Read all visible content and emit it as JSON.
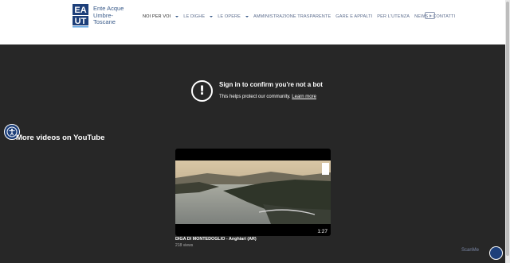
{
  "header": {
    "logo_lines": [
      "Ente Acque",
      "Umbre-",
      "Toscane"
    ],
    "nav": [
      {
        "label": "NOI PER VOI",
        "dropdown": true,
        "active": true
      },
      {
        "label": "LE DIGHE",
        "dropdown": true,
        "active": false
      },
      {
        "label": "LE OPERE",
        "dropdown": true,
        "active": false
      },
      {
        "label": "AMMINISTRAZIONE TRASPARENTE",
        "dropdown": false,
        "active": false
      },
      {
        "label": "GARE E APPALTI",
        "dropdown": false,
        "active": false
      },
      {
        "label": "PER L'UTENZA",
        "dropdown": false,
        "active": false
      },
      {
        "label": "NEWS",
        "dropdown": false,
        "active": false
      },
      {
        "label": "CONTATTI",
        "dropdown": false,
        "active": false
      }
    ],
    "social_icon": "youtube-icon"
  },
  "signin": {
    "title": "Sign in to confirm you're not a bot",
    "subtitle": "This helps protect our community.",
    "link": "Learn more",
    "icon": "exclamation-icon"
  },
  "more_videos": {
    "title": "More videos on YouTube"
  },
  "video": {
    "title": "DIGA DI MONTEDOGLIO - Anghiari (AR)",
    "views": "218 views",
    "duration": "1:27"
  },
  "widget": {
    "label": "ScanMe"
  },
  "colors": {
    "dark_bg": "#272727",
    "brand": "#1d3f7a",
    "nav_text": "#5a6b8c"
  }
}
